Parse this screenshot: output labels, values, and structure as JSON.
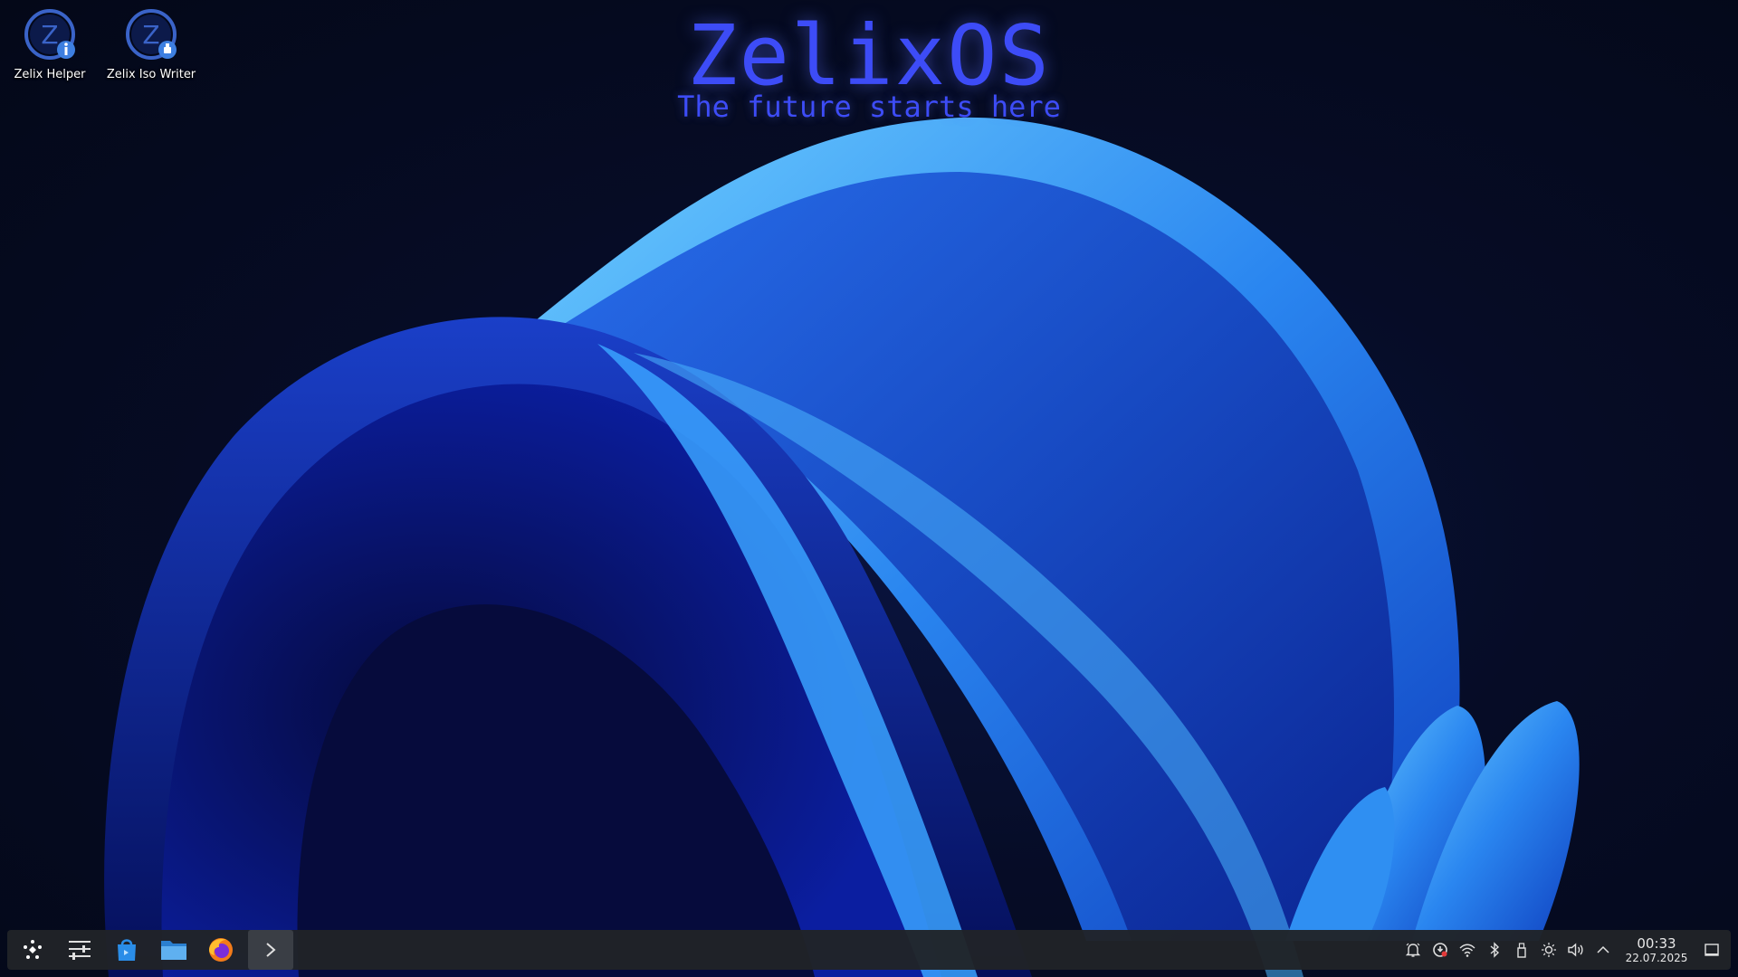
{
  "desktop": {
    "icons": [
      {
        "label": "Zelix Helper",
        "icon": "zelix-helper-icon"
      },
      {
        "label": "Zelix Iso Writer",
        "icon": "zelix-iso-writer-icon"
      }
    ],
    "brand_title": "ZelixOS",
    "brand_subtitle": "The future starts here",
    "colors": {
      "brand_text": "#3d4cf7",
      "taskbar": "#202328"
    }
  },
  "taskbar": {
    "launchers": [
      {
        "name": "application-launcher",
        "icon": "launcher-dots-icon"
      },
      {
        "name": "system-settings",
        "icon": "settings-sliders-icon"
      },
      {
        "name": "software-store",
        "icon": "store-bag-icon"
      },
      {
        "name": "file-manager",
        "icon": "folder-icon"
      },
      {
        "name": "firefox",
        "icon": "firefox-icon"
      },
      {
        "name": "terminal",
        "icon": "terminal-chevron-icon"
      }
    ],
    "tray": [
      {
        "name": "notifications",
        "icon": "bell-icon"
      },
      {
        "name": "updates",
        "icon": "update-icon"
      },
      {
        "name": "network",
        "icon": "wifi-icon"
      },
      {
        "name": "bluetooth",
        "icon": "bluetooth-icon"
      },
      {
        "name": "usb-devices",
        "icon": "usb-icon"
      },
      {
        "name": "brightness",
        "icon": "brightness-icon"
      },
      {
        "name": "volume",
        "icon": "volume-icon"
      },
      {
        "name": "show-hidden",
        "icon": "chevron-up-icon"
      }
    ],
    "clock": {
      "time": "00:33",
      "date": "22.07.2025"
    },
    "show_desktop": "show-desktop-icon"
  }
}
